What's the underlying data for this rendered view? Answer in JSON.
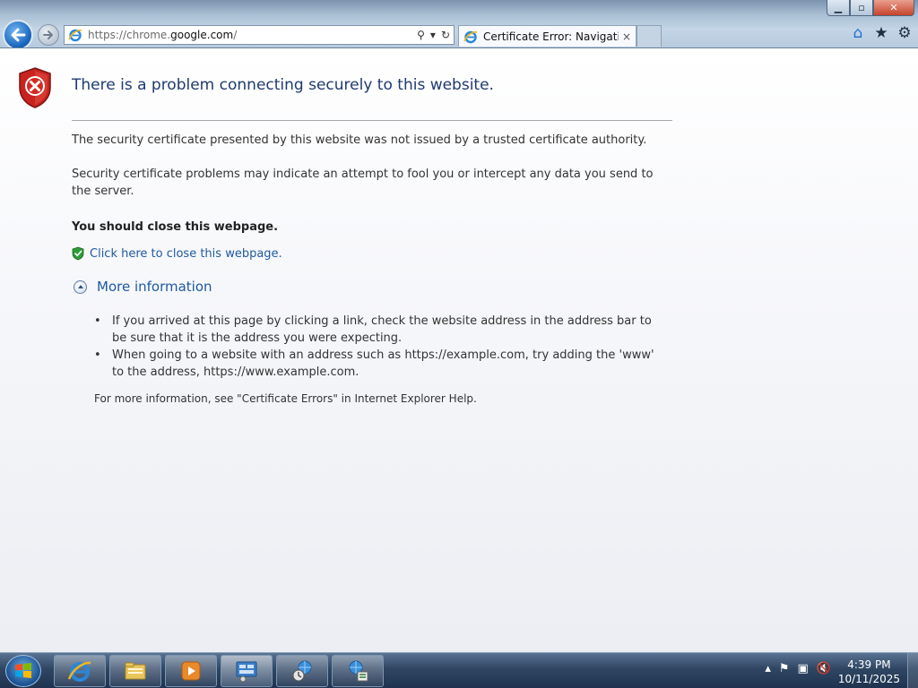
{
  "browser": {
    "address": {
      "prefix": "https://chrome.",
      "domain": "google.com",
      "suffix": "/"
    },
    "tab_title": "Certificate Error: Navigation...",
    "tab_close": "×",
    "window_controls": {
      "minimize": "▁",
      "maximize": "▫",
      "close": "✕"
    },
    "toolbar_icons": [
      "home-icon",
      "favorites-star-icon",
      "tools-gear-icon"
    ]
  },
  "page": {
    "title": "There is a problem connecting securely to this website.",
    "p1": "The security certificate presented by this website was not issued by a trusted certificate authority.",
    "p2": "Security certificate problems may indicate an attempt to fool you or intercept any data you send to the server.",
    "p3": "You should close this webpage.",
    "close_link": "Click here to close this webpage.",
    "more_info": "More information",
    "bullets": [
      "If you arrived at this page by clicking a link, check the website address in the address bar to be sure that it is the address you were expecting.",
      "When going to a website with an address such as https://example.com, try adding the 'www' to the address, https://www.example.com."
    ],
    "footnote": "For more information, see \"Certificate Errors\" in Internet Explorer Help."
  },
  "taskbar": {
    "apps": [
      "internet-explorer-icon",
      "file-explorer-icon",
      "media-player-icon",
      "control-panel-icon",
      "network-globe-icon",
      "network-setup-icon"
    ],
    "clock_time": "4:39 PM",
    "clock_date": "10/11/2025",
    "tray_icons": [
      "show-hidden-arrow-icon",
      "action-center-flag-icon",
      "network-icon",
      "volume-muted-icon"
    ]
  },
  "colors": {
    "title_blue": "#1f3a70",
    "link_blue": "#1f5aa0",
    "shield_red": "#c8231f"
  }
}
